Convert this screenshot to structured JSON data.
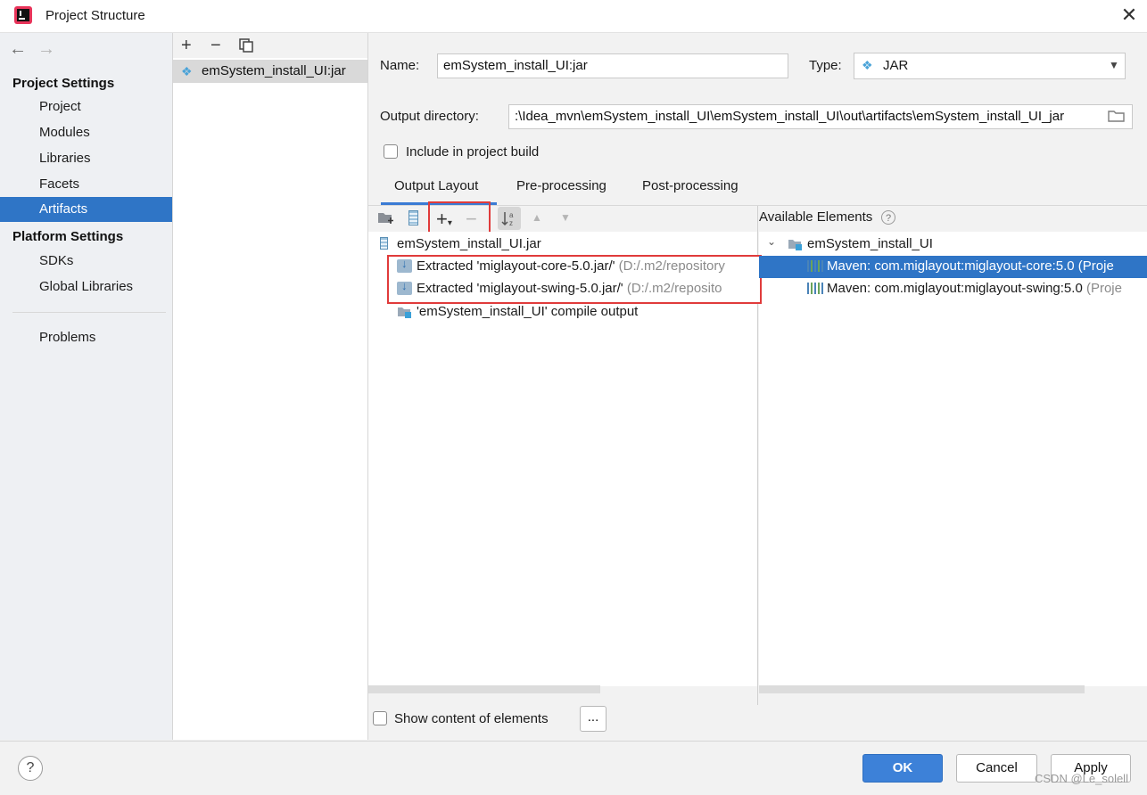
{
  "window": {
    "title": "Project Structure"
  },
  "sidebar": {
    "project_settings_header": "Project Settings",
    "project_items": [
      {
        "label": "Project"
      },
      {
        "label": "Modules"
      },
      {
        "label": "Libraries"
      },
      {
        "label": "Facets"
      },
      {
        "label": "Artifacts",
        "selected": true
      }
    ],
    "platform_settings_header": "Platform Settings",
    "platform_items": [
      {
        "label": "SDKs"
      },
      {
        "label": "Global Libraries"
      }
    ],
    "problems_label": "Problems"
  },
  "artifact_list": {
    "items": [
      {
        "label": "emSystem_install_UI:jar",
        "selected": true
      }
    ]
  },
  "form": {
    "name_label": "Name:",
    "name_value": "emSystem_install_UI:jar",
    "type_label": "Type:",
    "type_value": "JAR",
    "output_dir_label": "Output directory:",
    "output_dir_value": ":\\Idea_mvn\\emSystem_install_UI\\emSystem_install_UI\\out\\artifacts\\emSystem_install_UI_jar",
    "include_build_label": "Include in project build",
    "include_build_checked": false
  },
  "tabs": [
    {
      "label": "Output Layout",
      "active": true
    },
    {
      "label": "Pre-processing"
    },
    {
      "label": "Post-processing"
    }
  ],
  "output_tree": {
    "root": "emSystem_install_UI.jar",
    "items": [
      {
        "label": "Extracted 'miglayout-core-5.0.jar/'",
        "hint": "(D:/.m2/repository"
      },
      {
        "label": "Extracted 'miglayout-swing-5.0.jar/'",
        "hint": "(D:/.m2/reposito"
      },
      {
        "label": "'emSystem_install_UI' compile output"
      }
    ]
  },
  "available": {
    "header": "Available Elements",
    "module": "emSystem_install_UI",
    "items": [
      {
        "label": "Maven: com.miglayout:miglayout-core:5.0",
        "hint": "(Proje",
        "selected": true
      },
      {
        "label": "Maven: com.miglayout:miglayout-swing:5.0",
        "hint": "(Proje"
      }
    ]
  },
  "show_content_label": "Show content of elements",
  "ellipsis_label": "...",
  "buttons": {
    "ok": "OK",
    "cancel": "Cancel",
    "apply": "Apply"
  },
  "help_label": "?",
  "watermark": "CSDN @Le_solell",
  "colors": {
    "selection": "#2f75c6",
    "primary_button": "#3d81d8",
    "highlight_box": "#e03b3b"
  }
}
